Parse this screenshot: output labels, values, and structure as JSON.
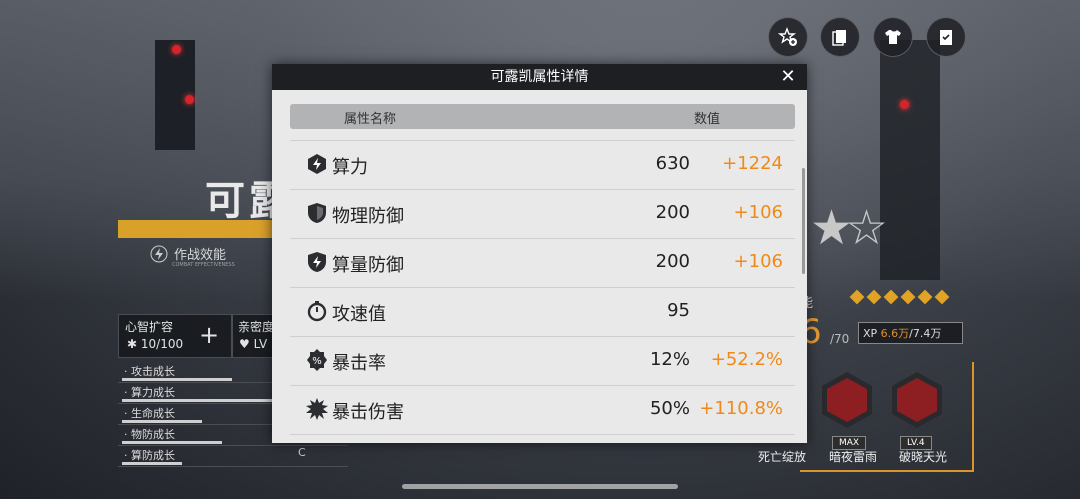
{
  "modal": {
    "title": "可露凯属性详情",
    "col_name": "属性名称",
    "col_value": "数值",
    "rows": [
      {
        "icon": "lightning-shield-icon",
        "label": "算力",
        "base": "630",
        "bonus": "+1224"
      },
      {
        "icon": "shield-icon",
        "label": "物理防御",
        "base": "200",
        "bonus": "+106"
      },
      {
        "icon": "lightning-shield-icon",
        "label": "算量防御",
        "base": "200",
        "bonus": "+106"
      },
      {
        "icon": "stopwatch-icon",
        "label": "攻速值",
        "base": "95",
        "bonus": ""
      },
      {
        "icon": "percent-badge-icon",
        "label": "暴击率",
        "base": "12%",
        "bonus": "+52.2%"
      },
      {
        "icon": "burst-icon",
        "label": "暴击伤害",
        "base": "50%",
        "bonus": "+110.8%"
      }
    ]
  },
  "background": {
    "character_name_partial": "可露",
    "combat_label": "作战效能",
    "combat_sub": "COMBAT EFFECTIVENESS",
    "mind_expand_label": "心智扩容",
    "mind_expand_value": "10/100",
    "affinity_label": "亲密度",
    "affinity_value": "LV",
    "growth_rows": [
      "· 攻击成长",
      "· 算力成长",
      "· 生命成长",
      "· 物防成长",
      "· 算防成长"
    ],
    "growth_grade": "C",
    "skill_section": "能",
    "level_digit": "6",
    "level_max": "/70",
    "xp_label": "XP",
    "xp_current": "6.6万",
    "xp_total": "/7.4万",
    "skills": [
      {
        "name": "死亡绽放",
        "tag": ""
      },
      {
        "name": "暗夜雷雨",
        "tag": "MAX"
      },
      {
        "name": "破晓天光",
        "tag": "LV.4"
      }
    ]
  },
  "colors": {
    "accent": "#ef8a1a",
    "header": "#1e1f23",
    "panel": "#e9e9e9"
  }
}
